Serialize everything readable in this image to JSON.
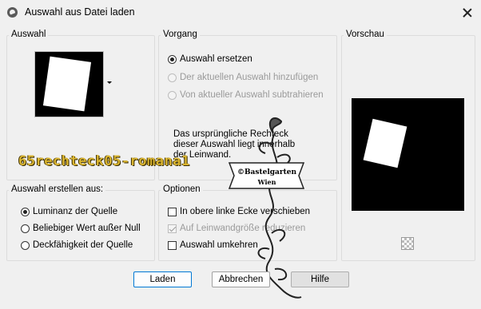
{
  "window": {
    "title": "Auswahl aus Datei laden"
  },
  "groups": {
    "auswahl": {
      "label": "Auswahl"
    },
    "vorgang": {
      "label": "Vorgang",
      "options": [
        {
          "label": "Auswahl ersetzen",
          "selected": true,
          "enabled": true
        },
        {
          "label": "Der aktuellen Auswahl hinzufügen",
          "selected": false,
          "enabled": false
        },
        {
          "label": "Von aktueller Auswahl subtrahieren",
          "selected": false,
          "enabled": false
        }
      ],
      "info_text": "Das ursprüngliche Rechteck dieser Auswahl liegt innerhalb der Leinwand."
    },
    "vorschau": {
      "label": "Vorschau"
    },
    "erstellen": {
      "label": "Auswahl erstellen aus:",
      "options": [
        {
          "label": "Luminanz der Quelle",
          "selected": true
        },
        {
          "label": "Beliebiger Wert außer Null",
          "selected": false
        },
        {
          "label": "Deckfähigkeit der Quelle",
          "selected": false
        }
      ]
    },
    "optionen": {
      "label": "Optionen",
      "checks": [
        {
          "label": "In obere linke Ecke verschieben",
          "checked": false,
          "enabled": true
        },
        {
          "label": "Auf Leinwandgröße reduzieren",
          "checked": true,
          "enabled": false
        },
        {
          "label": "Auswahl umkehren",
          "checked": false,
          "enabled": true
        }
      ]
    }
  },
  "buttons": {
    "load": "Laden",
    "cancel": "Abbrechen",
    "help": "Hilfe"
  },
  "watermark": {
    "filename": "65rechteck05-romana1",
    "logo_line1": "©Bastelgarten",
    "logo_line2": "Wien"
  },
  "colors": {
    "accent": "#0078d4",
    "filename_text": "#d9b430"
  }
}
